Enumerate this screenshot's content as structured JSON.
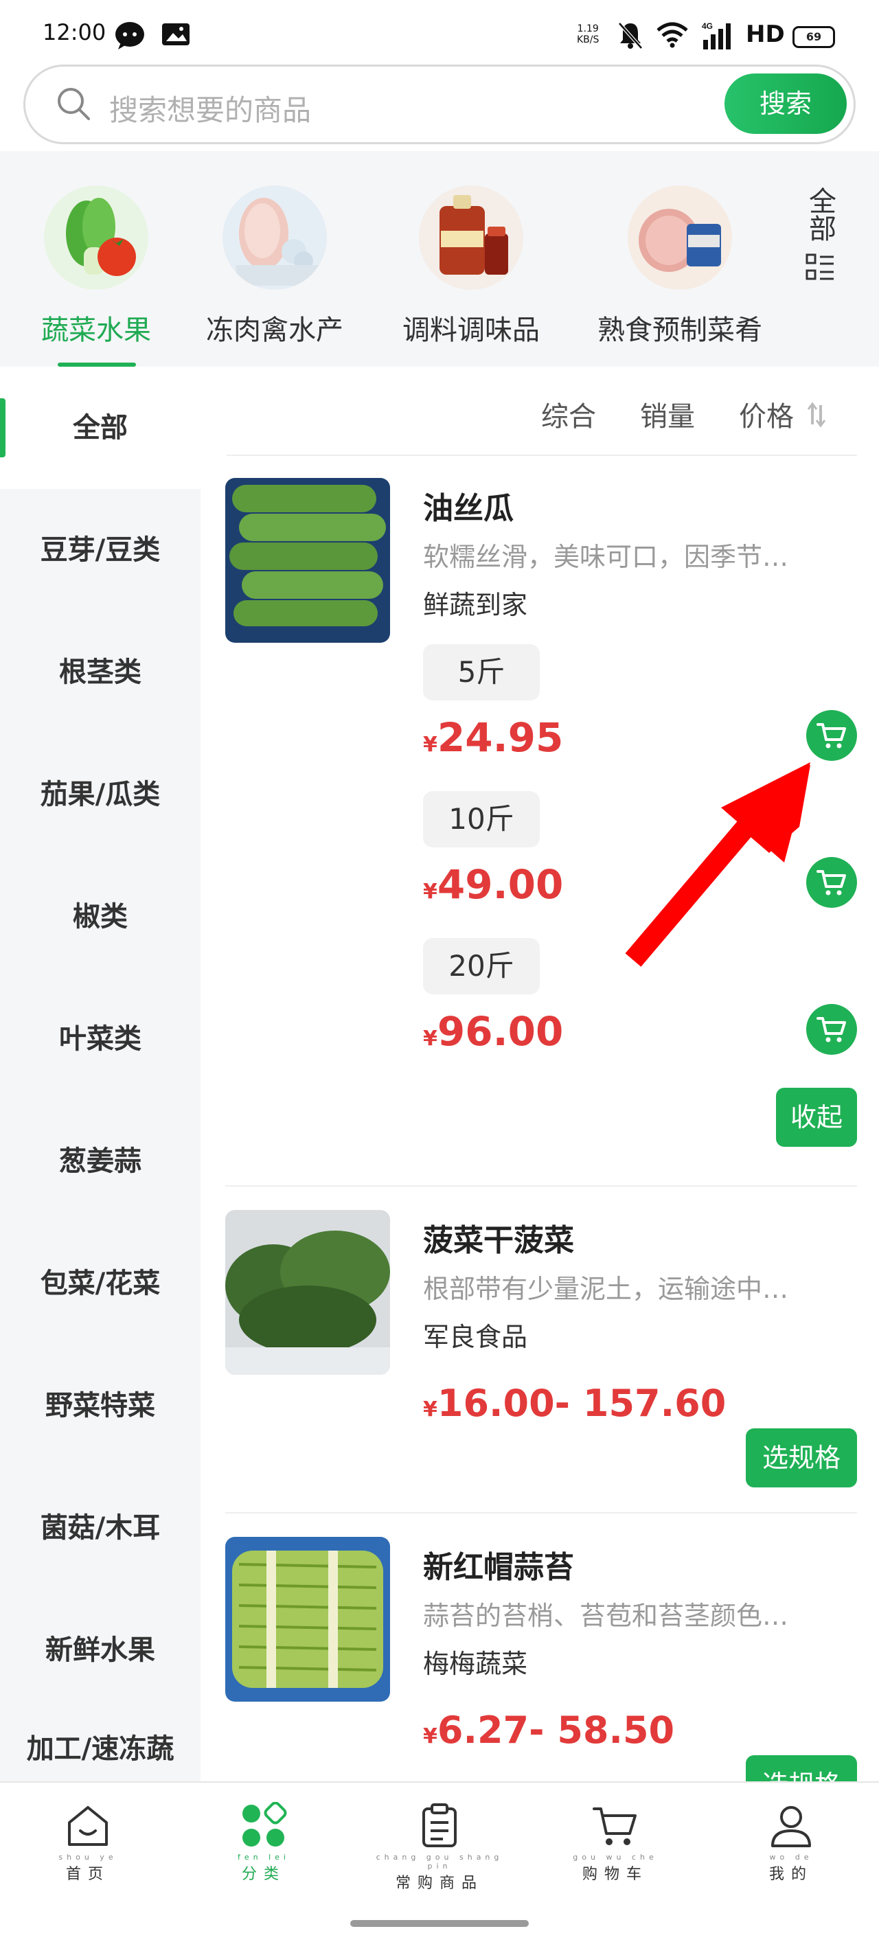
{
  "status_bar": {
    "time": "12:00",
    "net_speed_value": "1.19",
    "net_speed_unit": "KB/S",
    "network": "4G",
    "hd": "HD",
    "battery": "69",
    "icons": [
      "chat-bubble-icon",
      "image-icon",
      "mute-bell-icon",
      "wifi-icon",
      "signal-icon",
      "battery-icon"
    ]
  },
  "search": {
    "placeholder": "搜索想要的商品",
    "button": "搜索"
  },
  "categories": [
    {
      "label": "蔬菜水果",
      "icon": "vegetables-image",
      "active": true
    },
    {
      "label": "冻肉禽水产",
      "icon": "frozen-meat-image",
      "active": false
    },
    {
      "label": "调料调味品",
      "icon": "seasoning-image",
      "active": false
    },
    {
      "label": "熟食预制菜肴",
      "icon": "deli-image",
      "active": false
    }
  ],
  "categories_all": "全部",
  "sidebar": [
    {
      "label": "全部",
      "active": true
    },
    {
      "label": "豆芽/豆类"
    },
    {
      "label": "根茎类"
    },
    {
      "label": "茄果/瓜类"
    },
    {
      "label": "椒类"
    },
    {
      "label": "叶菜类"
    },
    {
      "label": "葱姜蒜"
    },
    {
      "label": "包菜/花菜"
    },
    {
      "label": "野菜特菜"
    },
    {
      "label": "菌菇/木耳"
    },
    {
      "label": "新鲜水果"
    },
    {
      "label": "加工/速冻蔬"
    }
  ],
  "sort": {
    "comprehensive": "综合",
    "sales": "销量",
    "price": "价格"
  },
  "products": [
    {
      "title": "油丝瓜",
      "desc": "软糯丝滑，美味可口，因季节…",
      "shop": "鲜蔬到家",
      "specs": [
        {
          "tag": "5斤",
          "currency": "¥",
          "price": "24.95"
        },
        {
          "tag": "10斤",
          "currency": "¥",
          "price": "49.00"
        },
        {
          "tag": "20斤",
          "currency": "¥",
          "price": "96.00"
        }
      ],
      "action": "收起"
    },
    {
      "title": "菠菜干菠菜",
      "desc": "根部带有少量泥土，运输途中…",
      "shop": "军良食品",
      "currency": "¥",
      "price": "16.00- 157.60",
      "action": "选规格"
    },
    {
      "title": "新红帽蒜苔",
      "desc": "蒜苔的苔梢、苔苞和苔茎颜色…",
      "shop": "梅梅蔬菜",
      "currency": "¥",
      "price": "6.27- 58.50",
      "action": "选规格"
    }
  ],
  "tabbar": [
    {
      "label": "首页",
      "pinyin": "shou ye",
      "icon": "home-icon"
    },
    {
      "label": "分类",
      "pinyin": "fen lei",
      "icon": "category-icon",
      "active": true
    },
    {
      "label": "常购商品",
      "pinyin": "chang gou shang pin",
      "icon": "clipboard-icon"
    },
    {
      "label": "购物车",
      "pinyin": "gou wu che",
      "icon": "cart-icon"
    },
    {
      "label": "我的",
      "pinyin": "wo de",
      "icon": "user-icon"
    }
  ],
  "colors": {
    "accent": "#1fb155",
    "price": "#e23a3a",
    "annotation_arrow": "#ff0000"
  }
}
